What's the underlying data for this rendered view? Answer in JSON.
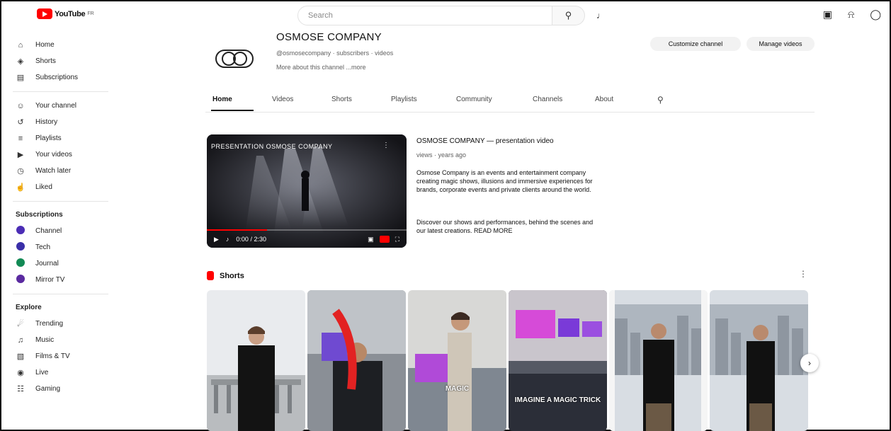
{
  "header": {
    "logo_text": "YouTube",
    "logo_region": "FR",
    "search_placeholder": "Search",
    "search_icon": "search-icon",
    "mic_icon": "mic-icon",
    "actions": [
      "create-icon",
      "notifications-icon",
      "account-icon"
    ]
  },
  "sidebar": {
    "main": [
      {
        "label": "Home",
        "icon": "home-icon"
      },
      {
        "label": "Shorts",
        "icon": "shorts-icon"
      },
      {
        "label": "Subscriptions",
        "icon": "subscriptions-icon"
      }
    ],
    "you": [
      {
        "label": "Your channel",
        "icon": "channel-icon"
      },
      {
        "label": "History",
        "icon": "history-icon"
      },
      {
        "label": "Playlists",
        "icon": "playlists-icon"
      },
      {
        "label": "Your videos",
        "icon": "videos-icon"
      },
      {
        "label": "Watch later",
        "icon": "clock-icon"
      },
      {
        "label": "Liked",
        "icon": "like-icon"
      }
    ],
    "subscriptions_title": "Subscriptions",
    "subscriptions": [
      {
        "label": "Channel",
        "color": "#4b2db5"
      },
      {
        "label": "Tech",
        "color": "#3a2fa8"
      },
      {
        "label": "Journal",
        "color": "#128a55"
      },
      {
        "label": "Mirror TV",
        "color": "#5a2aa0"
      }
    ],
    "explore_title": "Explore",
    "explore": [
      {
        "label": "Trending",
        "icon": "trending-icon"
      },
      {
        "label": "Music",
        "icon": "music-icon"
      },
      {
        "label": "Films & TV",
        "icon": "film-icon"
      },
      {
        "label": "Live",
        "icon": "live-icon"
      },
      {
        "label": "Gaming",
        "icon": "gaming-icon"
      }
    ]
  },
  "channel": {
    "name": "OSMOSE COMPANY",
    "meta": "@osmosecompany · subscribers · videos",
    "description": "More about this channel ...more",
    "customize_button": "Customize channel",
    "manage_button": "Manage videos"
  },
  "tabs": [
    "Home",
    "Videos",
    "Shorts",
    "Playlists",
    "Community",
    "Channels",
    "About"
  ],
  "tab_search_icon": "search-icon",
  "featured": {
    "overlay_title": "PRESENTATION OSMOSE COMPANY",
    "title": "OSMOSE COMPANY — presentation video",
    "sub": "views · years ago",
    "desc1": "Osmose Company is an events and entertainment company creating magic shows, illusions and immersive experiences for brands, corporate events and private clients around the world.",
    "desc2": "Discover our shows and performances, behind the scenes and our latest creations. READ MORE",
    "time": "0:00 / 2:30",
    "progress": 0.3
  },
  "shorts": {
    "label": "Shorts",
    "items": [
      {
        "caption": ""
      },
      {
        "caption": ""
      },
      {
        "caption": "MAGIC"
      },
      {
        "caption": "IMAGINE A MAGIC TRICK"
      },
      {
        "caption": ""
      },
      {
        "caption": ""
      }
    ]
  }
}
